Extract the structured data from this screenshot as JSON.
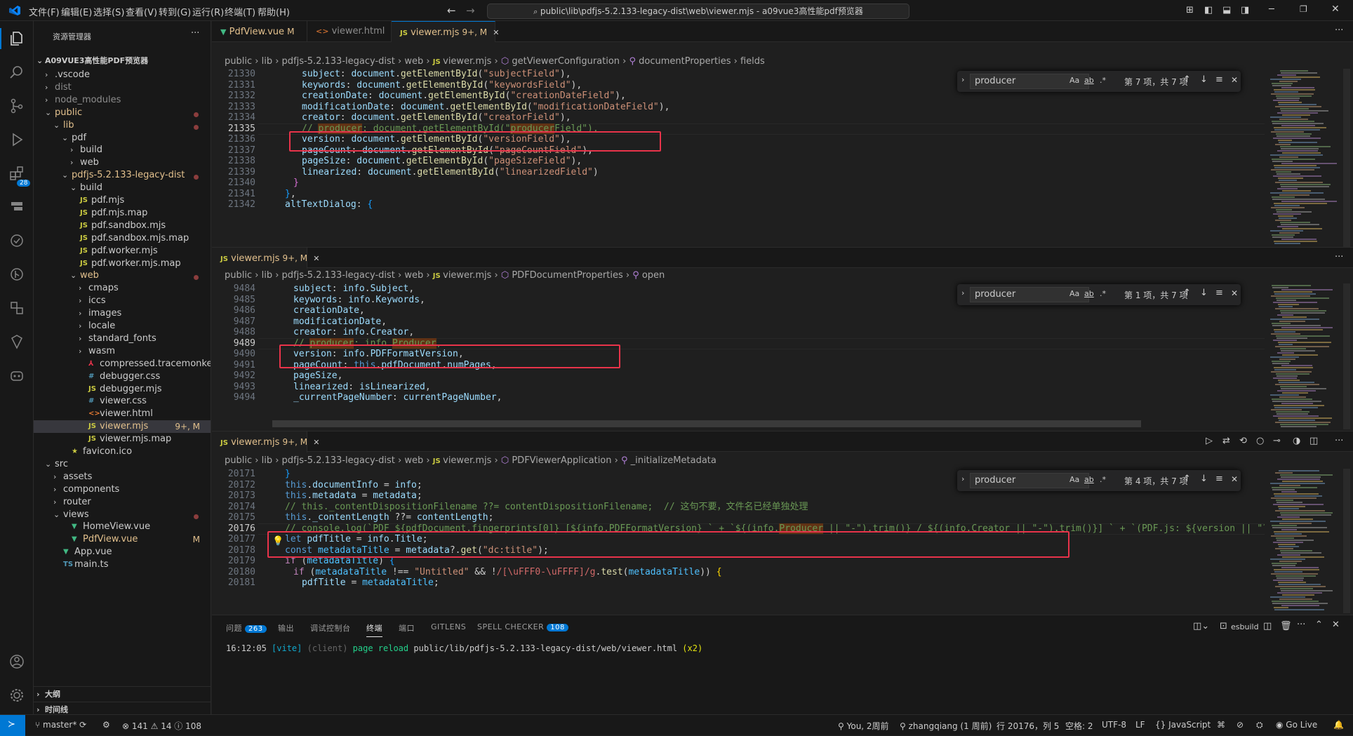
{
  "titlebar": {
    "menus": [
      "文件(F)",
      "编辑(E)",
      "选择(S)",
      "查看(V)",
      "转到(G)",
      "运行(R)",
      "终端(T)",
      "帮助(H)"
    ],
    "command_center": "public\\lib\\pdfjs-5.2.133-legacy-dist\\web\\viewer.mjs - a09vue3高性能pdf预览器"
  },
  "activity": {
    "extensions_badge": "28"
  },
  "sidebar": {
    "title": "资源管理器",
    "more": "···",
    "root": "A09VUE3高性能PDF预览器",
    "items": [
      {
        "label": ".vscode"
      },
      {
        "label": "dist"
      },
      {
        "label": "node_modules"
      },
      {
        "label": "public"
      },
      {
        "label": "lib"
      },
      {
        "label": "pdf"
      },
      {
        "label": "build"
      },
      {
        "label": "web"
      },
      {
        "label": "pdfjs-5.2.133-legacy-dist"
      },
      {
        "label": "build"
      },
      {
        "label": "pdf.mjs"
      },
      {
        "label": "pdf.mjs.map"
      },
      {
        "label": "pdf.sandbox.mjs"
      },
      {
        "label": "pdf.sandbox.mjs.map"
      },
      {
        "label": "pdf.worker.mjs"
      },
      {
        "label": "pdf.worker.mjs.map"
      },
      {
        "label": "web"
      },
      {
        "label": "cmaps"
      },
      {
        "label": "iccs"
      },
      {
        "label": "images"
      },
      {
        "label": "locale"
      },
      {
        "label": "standard_fonts"
      },
      {
        "label": "wasm"
      },
      {
        "label": "compressed.tracemonkey-pld..."
      },
      {
        "label": "debugger.css"
      },
      {
        "label": "debugger.mjs"
      },
      {
        "label": "viewer.css"
      },
      {
        "label": "viewer.html"
      },
      {
        "label": "viewer.mjs",
        "badge": "9+, M"
      },
      {
        "label": "viewer.mjs.map"
      },
      {
        "label": "favicon.ico"
      },
      {
        "label": "src"
      },
      {
        "label": "assets"
      },
      {
        "label": "components"
      },
      {
        "label": "router"
      },
      {
        "label": "views"
      },
      {
        "label": "HomeView.vue"
      },
      {
        "label": "PdfView.vue",
        "badge": "M"
      },
      {
        "label": "App.vue"
      },
      {
        "label": "main.ts"
      }
    ],
    "outline": "大纲",
    "timeline": "时间线"
  },
  "editor1": {
    "tabs": [
      {
        "label": "PdfView.vue",
        "mod": "M"
      },
      {
        "label": "viewer.html",
        "mod": ""
      },
      {
        "label": "viewer.mjs",
        "mod": "9+, M"
      }
    ],
    "breadcrumbs": [
      "public",
      "lib",
      "pdfjs-5.2.133-legacy-dist",
      "web",
      "viewer.mjs",
      "getViewerConfiguration",
      "documentProperties",
      "fields"
    ],
    "find_value": "producer",
    "find_count": "第 7 项，共 7 项",
    "line_numbers": [
      "21330",
      "21331",
      "21332",
      "21333",
      "21334",
      "21335",
      "21336",
      "21337",
      "21338",
      "21339",
      "21340",
      "21341",
      "21342"
    ]
  },
  "editor2": {
    "tab": {
      "label": "viewer.mjs",
      "mod": "9+, M"
    },
    "breadcrumbs": [
      "public",
      "lib",
      "pdfjs-5.2.133-legacy-dist",
      "web",
      "viewer.mjs",
      "PDFDocumentProperties",
      "open"
    ],
    "find_value": "producer",
    "find_count": "第 1 项，共 7 项",
    "line_numbers": [
      "9484",
      "9485",
      "9486",
      "9487",
      "9488",
      "9489",
      "9490",
      "9491",
      "9492",
      "9493",
      "9494"
    ]
  },
  "editor3": {
    "tab": {
      "label": "viewer.mjs",
      "mod": "9+, M"
    },
    "breadcrumbs": [
      "public",
      "lib",
      "pdfjs-5.2.133-legacy-dist",
      "web",
      "viewer.mjs",
      "PDFViewerApplication",
      "_initializeMetadata"
    ],
    "find_value": "producer",
    "find_count": "第 4 项，共 7 项",
    "line_numbers": [
      "20171",
      "20172",
      "20173",
      "20174",
      "20175",
      "20176",
      "20177",
      "20178",
      "20179",
      "20180",
      "20181"
    ]
  },
  "panel": {
    "tabs": [
      "问题",
      "输出",
      "调试控制台",
      "终端",
      "端口",
      "GITLENS",
      "SPELL CHECKER"
    ],
    "problems_badge": "263",
    "spell_badge": "108",
    "terminal_name": "esbuild",
    "log_time": "16:12:05",
    "log_tag": "[vite]",
    "log_client": "(client)",
    "log_msg": "page reload",
    "log_path": "public/lib/pdfjs-5.2.133-legacy-dist/web/viewer.html",
    "log_count": "(x2)"
  },
  "statusbar": {
    "branch": "master*",
    "errors": "141",
    "warnings": "14",
    "info": "108",
    "blame": "You, 2周前",
    "author": "zhangqiang (1 周前)",
    "position": "行 20176，列 5",
    "spaces": "空格: 2",
    "encoding": "UTF-8",
    "eol": "LF",
    "language": "JavaScript",
    "golive": "Go Live"
  },
  "colors": {
    "accent": "#0078d4",
    "highlight_box": "#e8334a",
    "match_bg": "#613214"
  }
}
